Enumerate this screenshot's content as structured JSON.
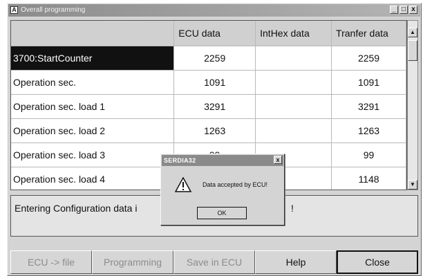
{
  "window": {
    "title": "Overall programming",
    "app_icon": "A",
    "controls": {
      "minimize": "_",
      "maximize": "□",
      "close": "x"
    }
  },
  "grid": {
    "columns": [
      "",
      "ECU data",
      "IntHex data",
      "Tranfer data"
    ],
    "rows": [
      {
        "label": "3700:StartCounter",
        "ecu": "2259",
        "inthex": "",
        "transfer": "2259",
        "selected": true
      },
      {
        "label": "Operation sec.",
        "ecu": "1091",
        "inthex": "",
        "transfer": "1091"
      },
      {
        "label": "Operation sec. load 1",
        "ecu": "3291",
        "inthex": "",
        "transfer": "3291"
      },
      {
        "label": "Operation sec. load 2",
        "ecu": "1263",
        "inthex": "",
        "transfer": "1263"
      },
      {
        "label": "Operation sec. load 3",
        "ecu": "99",
        "inthex": "",
        "transfer": "99"
      },
      {
        "label": "Operation sec. load 4",
        "ecu": "",
        "inthex": "",
        "transfer": "1148"
      }
    ],
    "scroll_up_icon": "▲",
    "scroll_down_icon": "▼"
  },
  "status": {
    "text_left": "Entering Configuration data i",
    "text_right": "!"
  },
  "buttons": {
    "ecu_to_file": "ECU -> file",
    "programming": "Programming",
    "save_in_ecu": "Save in ECU",
    "help": "Help",
    "close": "Close"
  },
  "dialog": {
    "title": "SERDIA32",
    "close": "x",
    "icon": "warning-icon",
    "message": "Data accepted by ECU!",
    "ok": "OK"
  }
}
